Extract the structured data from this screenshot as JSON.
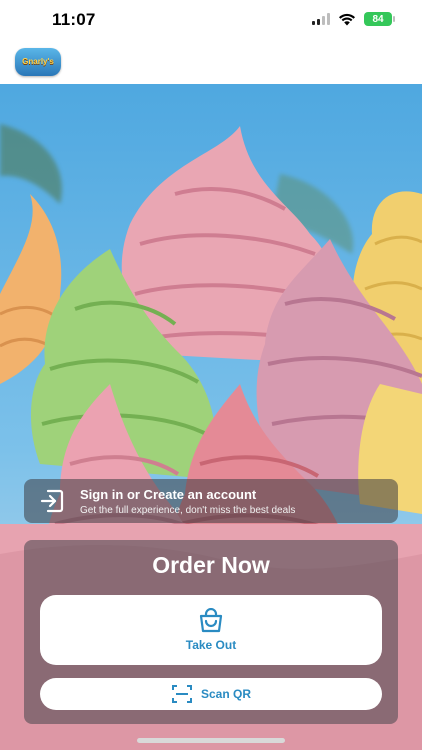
{
  "status_bar": {
    "time": "11:07",
    "battery": "84"
  },
  "header": {
    "logo_text": "Gnarly's",
    "logo_icon": "brand-logo"
  },
  "hero": {
    "image": "soft-serve-ice-cream-swirls",
    "colors": [
      "#e9a6b3",
      "#9fd27a",
      "#f1cf6e",
      "#d79bb0",
      "#f2b26d"
    ]
  },
  "signin": {
    "title": "Sign in or Create an account",
    "subtitle": "Get the full experience, don't miss the best deals",
    "icon": "sign-in-icon"
  },
  "order": {
    "title": "Order Now",
    "take_out": {
      "label": "Take Out",
      "icon": "shopping-bag-icon"
    },
    "scan_qr": {
      "label": "Scan QR",
      "icon": "qr-scan-icon"
    }
  },
  "colors": {
    "accent": "#2a8bc2",
    "battery": "#34c759"
  }
}
